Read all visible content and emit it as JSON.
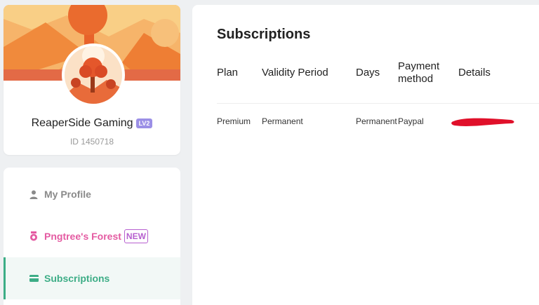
{
  "profile": {
    "username": "ReaperSide Gaming",
    "level_badge": "LV2",
    "user_id": "ID 1450718"
  },
  "sidebar": {
    "items": [
      {
        "label": "My Profile",
        "icon": "person-icon",
        "color": "#8a8a8a"
      },
      {
        "label": "Pngtree's Forest",
        "icon": "medal-icon",
        "badge": "NEW",
        "color": "#e45ba2"
      },
      {
        "label": "Subscriptions",
        "icon": "card-icon",
        "color": "#3dad86",
        "active": true
      }
    ]
  },
  "main": {
    "title": "Subscriptions",
    "table": {
      "headers": [
        "Plan",
        "Validity Period",
        "Days",
        "Payment method",
        "Details"
      ],
      "rows": [
        [
          "Premium",
          "Permanent",
          "Permanent",
          "Paypal",
          ""
        ]
      ]
    }
  },
  "colors": {
    "accent_green": "#3dad86",
    "forest_pink": "#e45ba2",
    "level_purple": "#9b8fe6",
    "new_purple": "#b65fcf",
    "redaction_red": "#e0102a"
  }
}
